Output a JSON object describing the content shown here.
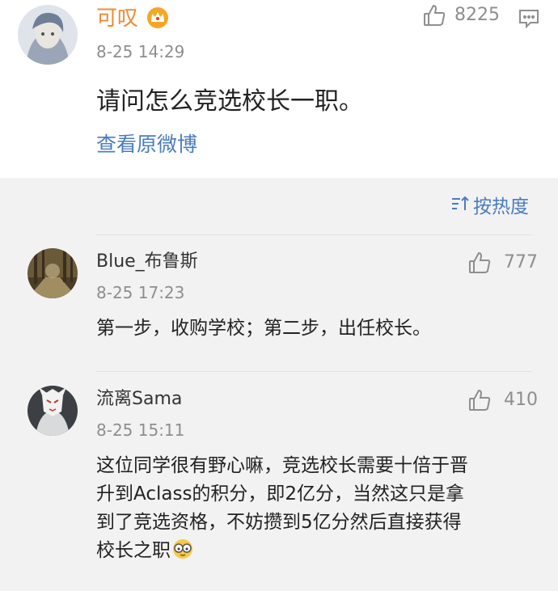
{
  "post": {
    "author": "可叹",
    "time": "8-25 14:29",
    "likes": "8225",
    "text": "请问怎么竞选校长一职。",
    "view_original": "查看原微博"
  },
  "sort_label": "按热度",
  "comments": [
    {
      "name": "Blue_布鲁斯",
      "time": "8-25 17:23",
      "likes": "777",
      "lines": [
        "第一步，收购学校；第二步，出任校长。"
      ]
    },
    {
      "name": "流离Sama",
      "time": "8-25 15:11",
      "likes": "410",
      "lines": [
        "这位同学很有野心嘛，竞选校长需要十倍于晋",
        "升到Aclass的积分，即2亿分，当然这只是拿",
        "到了竞选资格，不妨攒到5亿分然后直接获得",
        "校长之职"
      ]
    }
  ],
  "icons": {
    "vip": "crown-icon",
    "like": "thumbs-up-icon",
    "comment": "comment-icon",
    "sort": "sort-icon",
    "emoji": "glasses-emoji-icon"
  },
  "colors": {
    "author": "#f08a33",
    "link": "#4a7cbf",
    "meta": "#8e8e8e",
    "background": "#f2f2f2"
  }
}
